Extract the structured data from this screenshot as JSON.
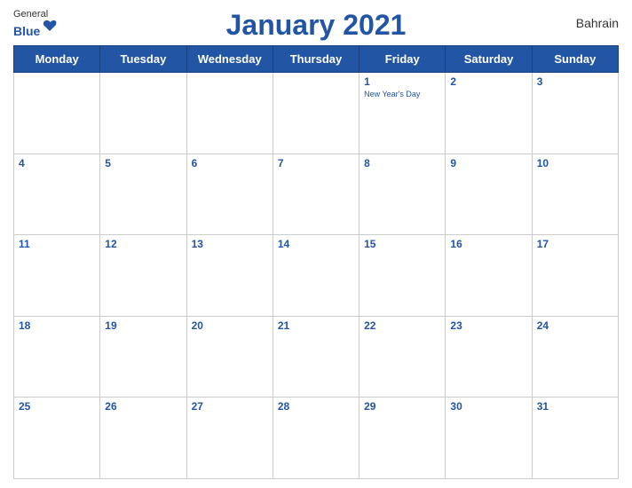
{
  "header": {
    "title": "January 2021",
    "country": "Bahrain",
    "logo": {
      "general": "General",
      "blue": "Blue"
    }
  },
  "weekdays": [
    "Monday",
    "Tuesday",
    "Wednesday",
    "Thursday",
    "Friday",
    "Saturday",
    "Sunday"
  ],
  "weeks": [
    [
      {
        "day": null
      },
      {
        "day": null
      },
      {
        "day": null
      },
      {
        "day": null
      },
      {
        "day": 1,
        "holiday": "New Year's Day"
      },
      {
        "day": 2
      },
      {
        "day": 3
      }
    ],
    [
      {
        "day": 4
      },
      {
        "day": 5
      },
      {
        "day": 6
      },
      {
        "day": 7
      },
      {
        "day": 8
      },
      {
        "day": 9
      },
      {
        "day": 10
      }
    ],
    [
      {
        "day": 11
      },
      {
        "day": 12
      },
      {
        "day": 13
      },
      {
        "day": 14
      },
      {
        "day": 15
      },
      {
        "day": 16
      },
      {
        "day": 17
      }
    ],
    [
      {
        "day": 18
      },
      {
        "day": 19
      },
      {
        "day": 20
      },
      {
        "day": 21
      },
      {
        "day": 22
      },
      {
        "day": 23
      },
      {
        "day": 24
      }
    ],
    [
      {
        "day": 25
      },
      {
        "day": 26
      },
      {
        "day": 27
      },
      {
        "day": 28
      },
      {
        "day": 29
      },
      {
        "day": 30
      },
      {
        "day": 31
      }
    ]
  ]
}
